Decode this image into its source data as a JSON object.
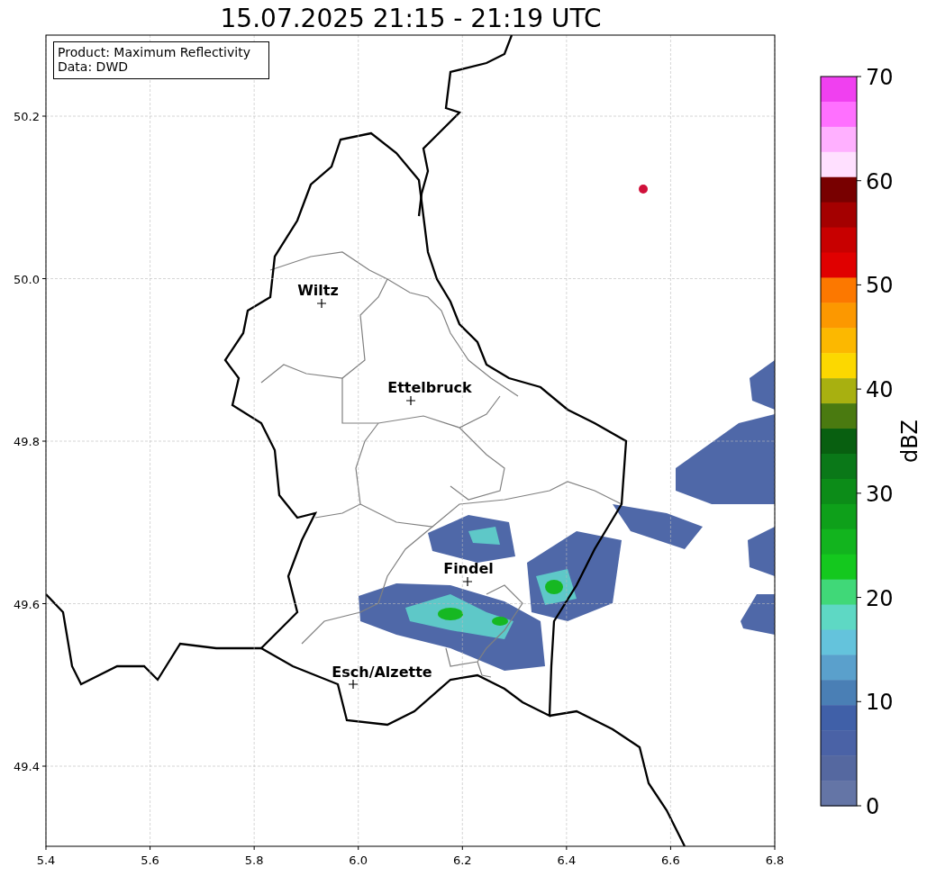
{
  "title": "15.07.2025 21:15 - 21:19 UTC",
  "legend": [
    "Product: Maximum Reflectivity",
    "Data: DWD"
  ],
  "map": {
    "x_tick_labels": [
      "5.4",
      "5.6",
      "5.8",
      "6.0",
      "6.2",
      "6.4",
      "6.6",
      "6.8"
    ],
    "y_tick_labels": [
      "50.2",
      "50.0",
      "49.8",
      "49.6",
      "49.4"
    ],
    "cities": [
      {
        "name": "Wiltz"
      },
      {
        "name": "Ettelbruck"
      },
      {
        "name": "Findel"
      },
      {
        "name": "Esch/Alzette"
      }
    ]
  },
  "colorbar": {
    "label": "dBZ",
    "ticks": [
      "70",
      "60",
      "50",
      "40",
      "30",
      "20",
      "10",
      "0"
    ],
    "segments": [
      {
        "color": "#f040f0"
      },
      {
        "color": "#ff70ff"
      },
      {
        "color": "#ffb0ff"
      },
      {
        "color": "#ffe0ff"
      },
      {
        "color": "#780000"
      },
      {
        "color": "#a40000"
      },
      {
        "color": "#c80000"
      },
      {
        "color": "#e00000"
      },
      {
        "color": "#fc7800"
      },
      {
        "color": "#fc9800"
      },
      {
        "color": "#fcb800"
      },
      {
        "color": "#fcd800"
      },
      {
        "color": "#a8b010"
      },
      {
        "color": "#4a7a10"
      },
      {
        "color": "#085f10"
      },
      {
        "color": "#0a7818"
      },
      {
        "color": "#0c8c18"
      },
      {
        "color": "#0ea01a"
      },
      {
        "color": "#12b41e"
      },
      {
        "color": "#14c81e"
      },
      {
        "color": "#40d878"
      },
      {
        "color": "#5ed8c4"
      },
      {
        "color": "#64c3dc"
      },
      {
        "color": "#5aa0cc"
      },
      {
        "color": "#4a7fb5"
      },
      {
        "color": "#4060a8"
      },
      {
        "color": "#4a62a6"
      },
      {
        "color": "#5568a0"
      },
      {
        "color": "#6475a6"
      }
    ]
  }
}
